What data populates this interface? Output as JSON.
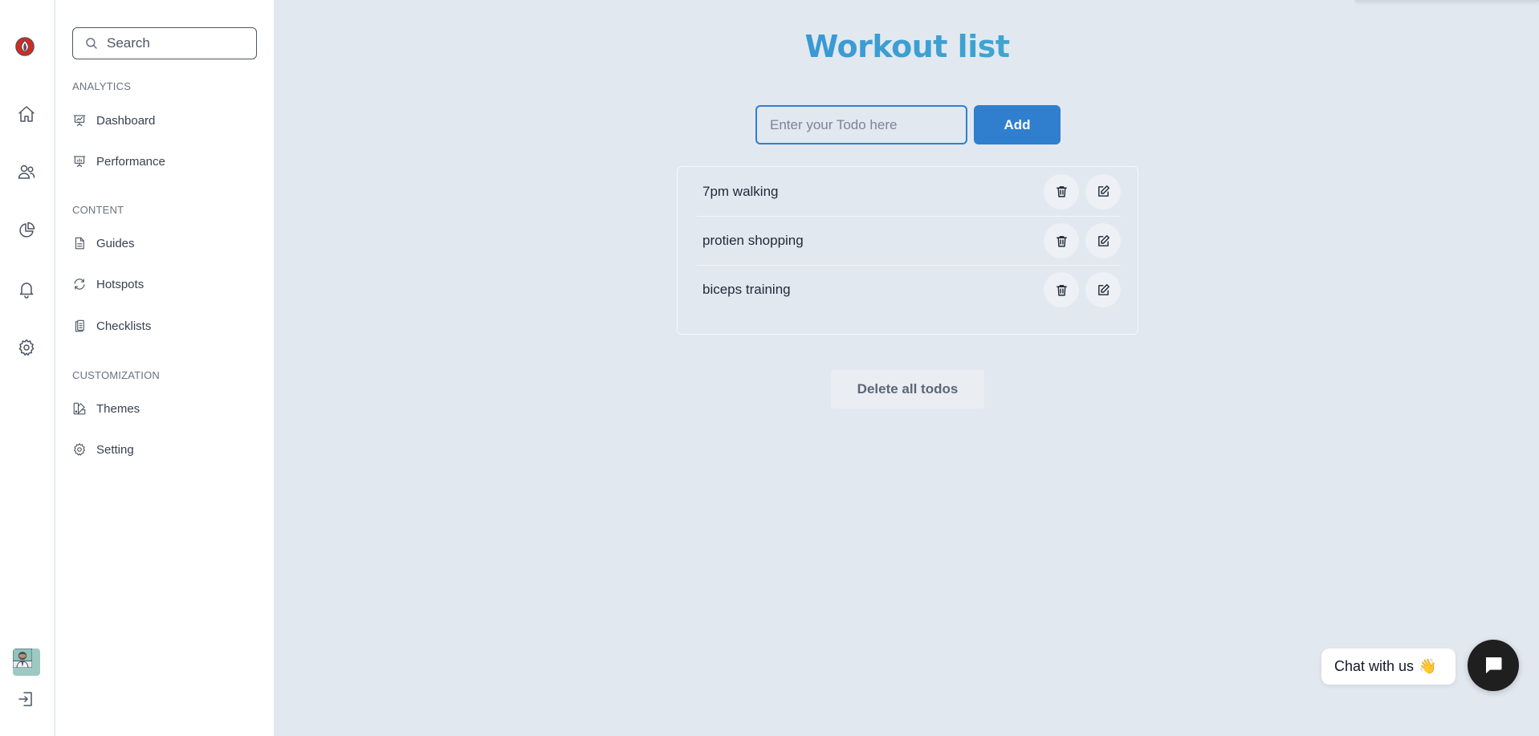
{
  "sidebar": {
    "search_placeholder": "Search",
    "sections": [
      {
        "title": "ANALYTICS",
        "items": [
          {
            "label": "Dashboard",
            "icon": "presentation-chart-icon"
          },
          {
            "label": "Performance",
            "icon": "bar-chart-icon"
          }
        ]
      },
      {
        "title": "CONTENT",
        "items": [
          {
            "label": "Guides",
            "icon": "document-icon"
          },
          {
            "label": "Hotspots",
            "icon": "refresh-icon"
          },
          {
            "label": "Checklists",
            "icon": "clipboard-icon"
          }
        ]
      },
      {
        "title": "CUSTOMIZATION",
        "items": [
          {
            "label": "Themes",
            "icon": "swatch-icon"
          },
          {
            "label": "Setting",
            "icon": "gear-icon"
          }
        ]
      }
    ]
  },
  "rail": {
    "icons": [
      "logo-icon",
      "home-icon",
      "users-icon",
      "pie-chart-icon",
      "bell-icon",
      "gear-icon",
      "avatar",
      "logout-icon"
    ]
  },
  "main": {
    "title": "Workout list",
    "input_placeholder": "Enter your Todo here",
    "add_label": "Add",
    "todos": [
      "7pm walking",
      "protien shopping",
      "biceps training"
    ],
    "delete_all_label": "Delete all todos"
  },
  "chat": {
    "label": "Chat with us",
    "emoji": "👋"
  },
  "colors": {
    "accent": "#2f7fce",
    "title_gradient_start": "#2b7bc9",
    "title_gradient_end": "#4cc6c4",
    "background": "#e2e8f0"
  }
}
